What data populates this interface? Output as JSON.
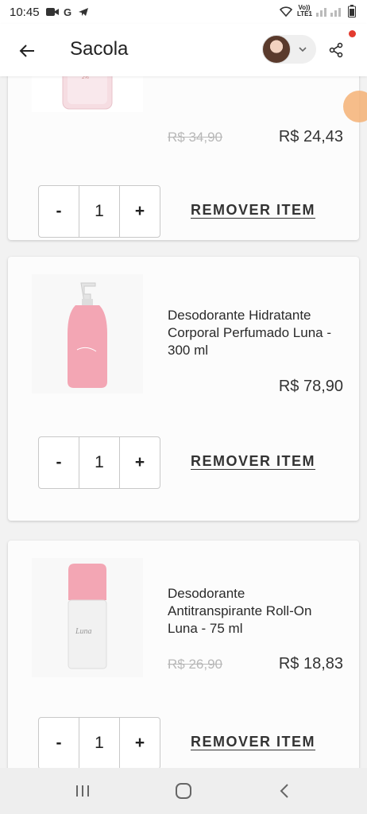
{
  "status_bar": {
    "time": "10:45",
    "network_label": "Vo)) LTE1"
  },
  "header": {
    "title": "Sacola"
  },
  "items": [
    {
      "name": "",
      "old_price": "R$ 34,90",
      "price": "R$ 24,43",
      "quantity": "1",
      "minus": "-",
      "plus": "+",
      "remove": "REMOVER ITEM"
    },
    {
      "name": "Desodorante Hidratante Corporal Perfumado Luna - 300 ml",
      "old_price": "",
      "price": "R$ 78,90",
      "quantity": "1",
      "minus": "-",
      "plus": "+",
      "remove": "REMOVER ITEM"
    },
    {
      "name": "Desodorante Antitranspirante Roll-On Luna - 75 ml",
      "old_price": "R$ 26,90",
      "price": "R$ 18,83",
      "quantity": "1",
      "minus": "-",
      "plus": "+",
      "remove": "REMOVER ITEM"
    }
  ],
  "colors": {
    "accent_dot": "#e33b2f",
    "product_pink": "#f3a6b4"
  }
}
